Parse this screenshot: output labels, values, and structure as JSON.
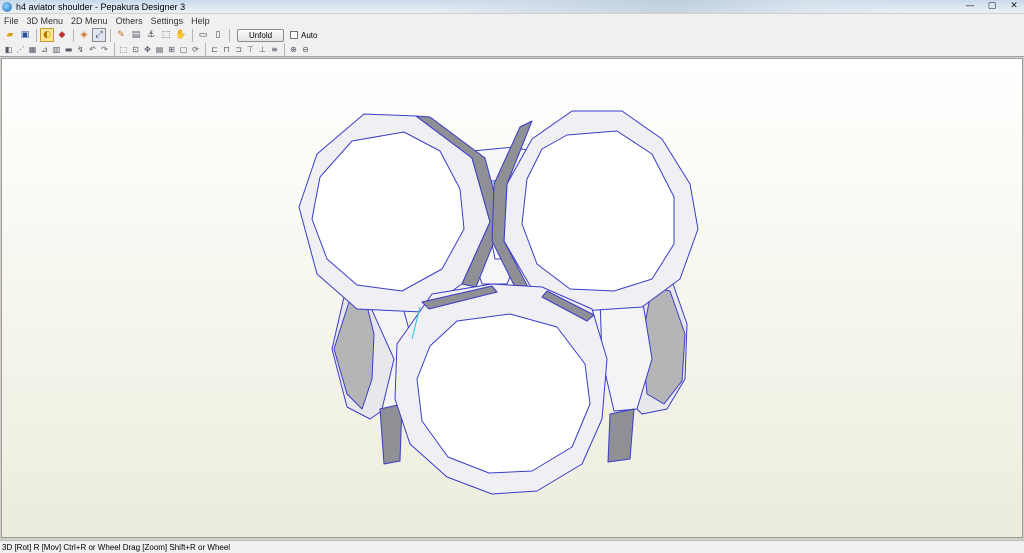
{
  "window": {
    "title": "h4 aviator shoulder - Pepakura Designer 3",
    "controls": [
      "—",
      "▢",
      "✕"
    ]
  },
  "menubar": {
    "items": [
      "File",
      "3D Menu",
      "2D Menu",
      "Others",
      "Settings",
      "Help"
    ]
  },
  "toolbar": {
    "unfold_label": "Unfold",
    "auto_label": "Auto",
    "icons": [
      "open-icon",
      "save-icon",
      "light-icon",
      "color-icon",
      "rotate-icon",
      "view-icon",
      "pencil-icon",
      "cube-icon",
      "anchor-icon",
      "move-icon",
      "hand-icon",
      "single-view-icon",
      "dual-view-icon"
    ]
  },
  "status": {
    "text": "3D [Rot] R [Mov] Ctrl+R or Wheel Drag [Zoom] Shift+R or Wheel"
  },
  "colors": {
    "edge": "#3a3cc6",
    "fold_line": "#2ec4d6",
    "face": "#ffffff",
    "shaded_face": "#b5b5b8",
    "viewport_top": "#ffffff",
    "viewport_bottom": "#ececdd"
  }
}
